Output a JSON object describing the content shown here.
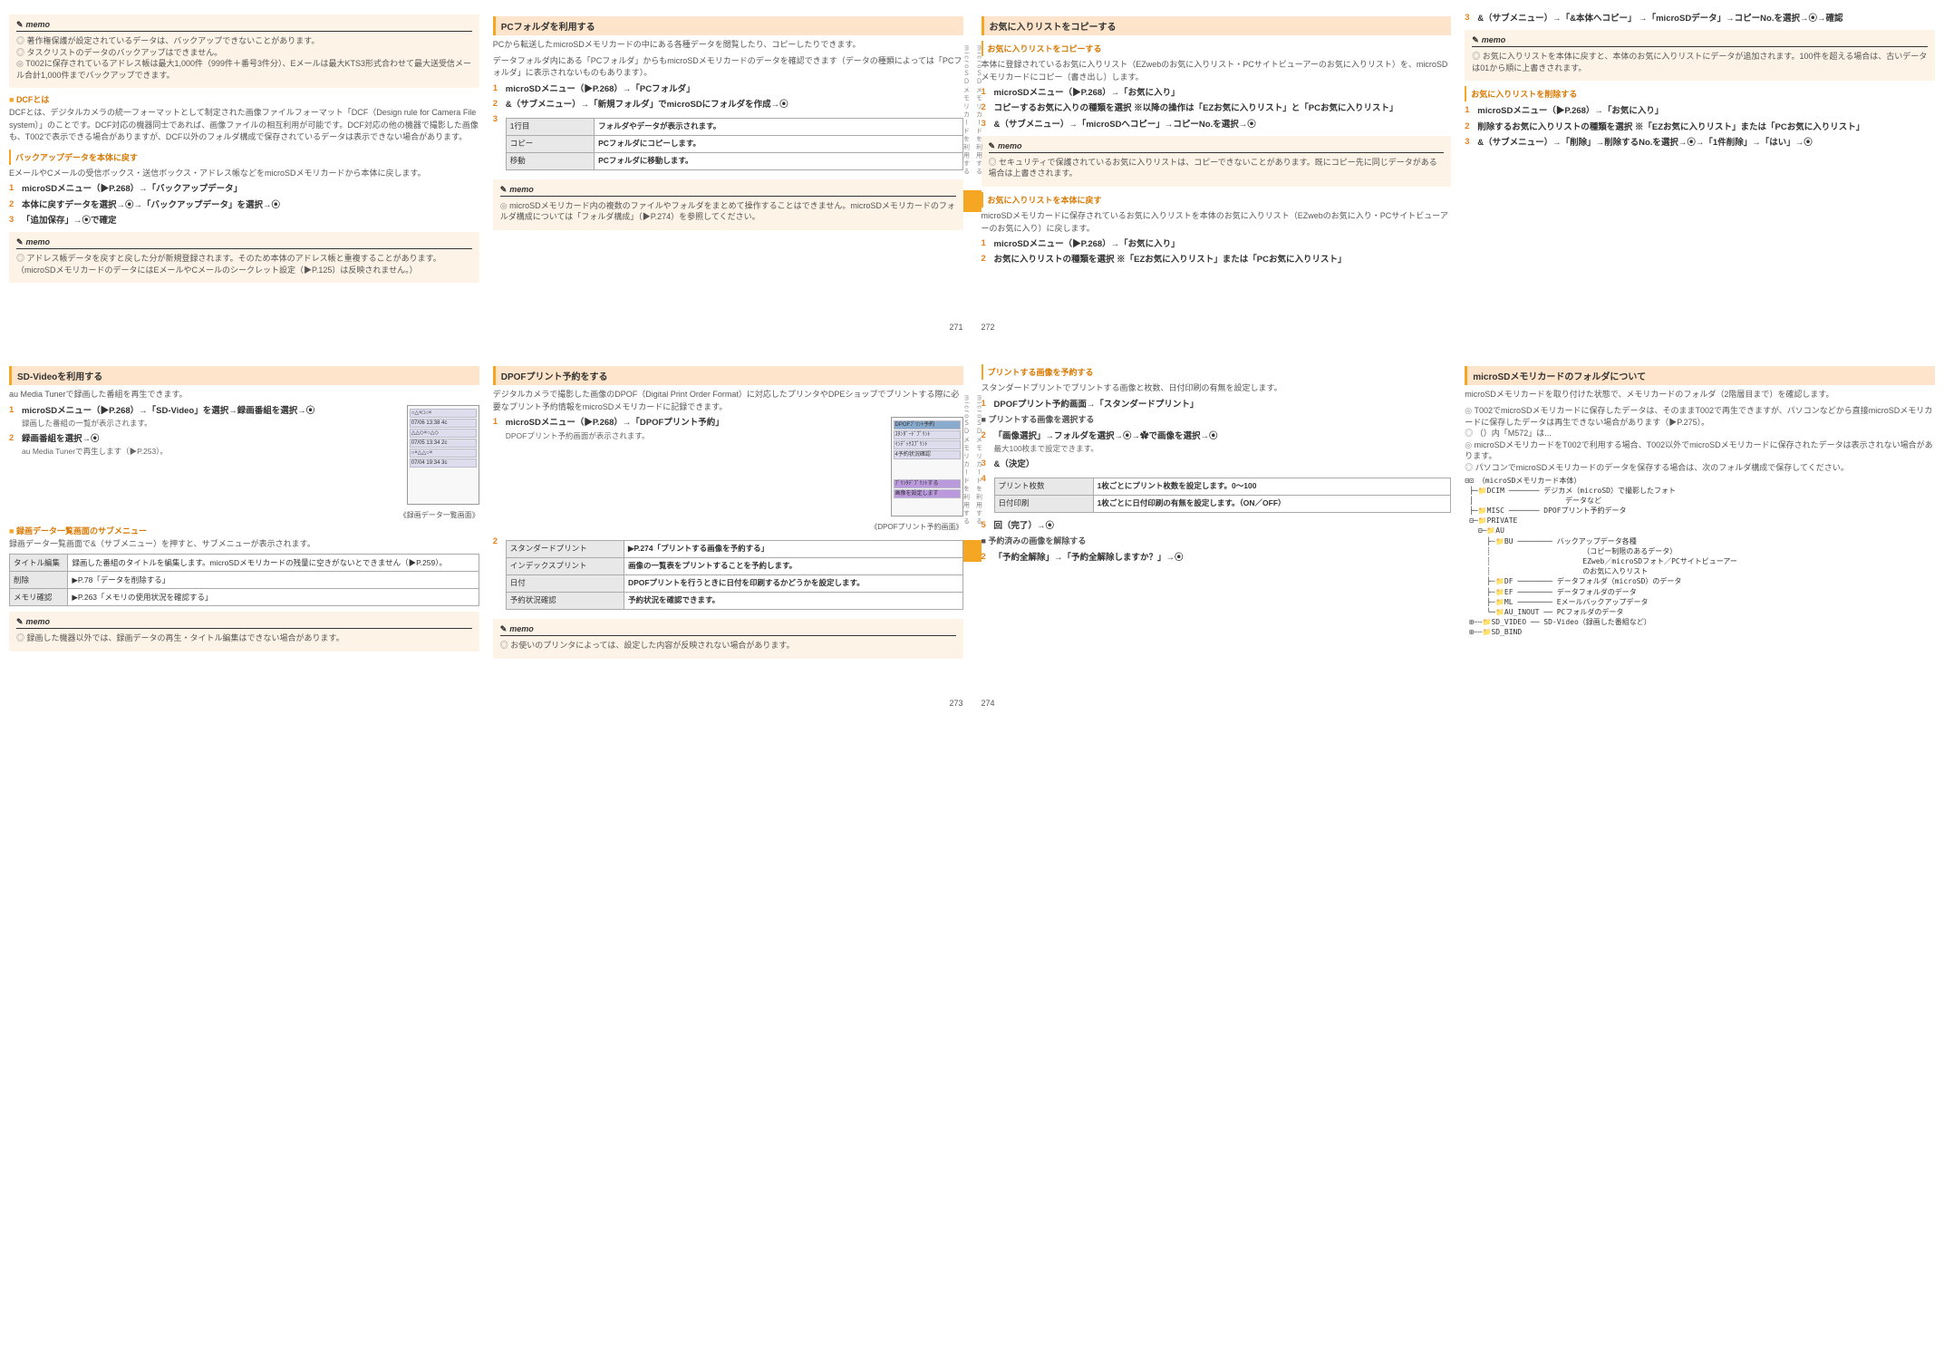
{
  "pageNumbers": [
    "271",
    "272",
    "273",
    "274"
  ],
  "sideLabel": "microＳＤメモリカードを利用する",
  "row1": {
    "colA": {
      "memo1": {
        "title": "memo",
        "items": [
          "著作権保護が設定されているデータは、バックアップできないことがあります。",
          "タスクリストのデータのバックアップはできません。",
          "T002に保存されているアドレス帳は最大1,000件（999件＋番号3件分）、Eメールは最大KTS3形式合わせて最大送受信メール合計1,000件までバックアップできます。"
        ]
      },
      "dcfHdr": "DCFとは",
      "dcfBody": "DCFとは、デジタルカメラの統一フォーマットとして制定された画像ファイルフォーマット「DCF（Design rule for Camera File system）」のことです。DCF対応の機器同士であれば、画像ファイルの相互利用が可能です。DCF対応の他の機器で撮影した画像も、T002で表示できる場合がありますが、DCF以外のフォルダ構成で保存されているデータは表示できない場合があります。",
      "restoreHdr": "バックアップデータを本体に戻す",
      "restoreBody": "EメールやCメールの受信ボックス・送信ボックス・アドレス帳などをmicroSDメモリカードから本体に戻します。",
      "restoreSteps": [
        {
          "n": "1",
          "t": "microSDメニュー（▶P.268）→「バックアップデータ」"
        },
        {
          "n": "2",
          "t": "本体に戻すデータを選択→⦿→「バックアップデータ」を選択→⦿"
        },
        {
          "n": "3",
          "t": "「追加保存」→⦿で確定",
          "sub": ""
        }
      ],
      "memo2": {
        "title": "memo",
        "items": [
          "アドレス帳データを戻すと戻した分が新規登録されます。そのため本体のアドレス帳と重複することがあります。（microSDメモリカードのデータにはEメールやCメールのシークレット設定（▶P.125）は反映されません。）"
        ]
      }
    },
    "colB": {
      "hdr": "PCフォルダを利用する",
      "body1": "PCから転送したmicroSDメモリカードの中にある各種データを閲覧したり、コピーしたりできます。",
      "body2": "データフォルダ内にある「PCフォルダ」からもmicroSDメモリカードのデータを確認できます（データの種類によっては「PCフォルダ」に表示されないものもあります）。",
      "steps": [
        {
          "n": "1",
          "t": "microSDメニュー（▶P.268）→「PCフォルダ」"
        },
        {
          "n": "2",
          "t": "&（サブメニュー）→「新規フォルダ」でmicroSDにフォルダを作成→⦿"
        },
        {
          "n": "3",
          "t": ""
        }
      ],
      "table": [
        [
          "1行目",
          "フォルダやデータが表示されます。"
        ],
        [
          "コピー",
          "PCフォルダにコピーします。"
        ],
        [
          "移動",
          "PCフォルダに移動します。"
        ]
      ],
      "memo": {
        "title": "memo",
        "items": [
          "microSDメモリカード内の複数のファイルやフォルダをまとめて操作することはできません。microSDメモリカードのフォルダ構成については「フォルダ構成」（▶P.274）を参照してください。"
        ]
      }
    },
    "colC": {
      "hdr": "お気に入りリストをコピーする",
      "subhdr": "お気に入りリストをコピーする",
      "body": "本体に登録されているお気に入りリスト（EZwebのお気に入りリスト・PCサイトビューアーのお気に入りリスト）を、microSDメモリカードにコピー（書き出し）します。",
      "steps": [
        {
          "n": "1",
          "t": "microSDメニュー（▶P.268）→「お気に入り」"
        },
        {
          "n": "2",
          "t": "コピーするお気に入りの種類を選択 ※以降の操作は「EZお気に入りリスト」と「PCお気に入りリスト」"
        },
        {
          "n": "3",
          "t": "&（サブメニュー）→「microSDへコピー」→コピーNo.を選択→⦿"
        }
      ],
      "memo": {
        "title": "memo",
        "items": [
          "セキュリティで保護されているお気に入りリストは、コピーできないことがあります。既にコピー先に同じデータがある場合は上書きされます。"
        ]
      },
      "subhdr2": "お気に入りリストを本体に戻す",
      "body2": "microSDメモリカードに保存されているお気に入りリストを本体のお気に入りリスト（EZwebのお気に入り・PCサイトビューアーのお気に入り）に戻します。",
      "steps2": [
        {
          "n": "1",
          "t": "microSDメニュー（▶P.268）→「お気に入り」"
        },
        {
          "n": "2",
          "t": "お気に入りリストの種類を選択 ※「EZお気に入りリスト」または「PCお気に入りリスト」"
        }
      ]
    },
    "colD": {
      "step3": {
        "n": "3",
        "t": "&（サブメニュー）→「&本体へコピー」 →「microSDデータ」→コピーNo.を選択→⦿→確認"
      },
      "memo": {
        "title": "memo",
        "items": [
          "お気に入りリストを本体に戻すと、本体のお気に入りリストにデータが追加されます。100件を超える場合は、古いデータは01から順に上書きされます。"
        ]
      },
      "subhdr": "お気に入りリストを削除する",
      "steps": [
        {
          "n": "1",
          "t": "microSDメニュー（▶P.268）→「お気に入り」"
        },
        {
          "n": "2",
          "t": "削除するお気に入りリストの種類を選択 ※「EZお気に入りリスト」または「PCお気に入りリスト」"
        },
        {
          "n": "3",
          "t": "&（サブメニュー）→「削除」→削除するNo.を選択→⦿→「1件削除」→「はい」→⦿"
        }
      ]
    }
  },
  "row2": {
    "colA": {
      "hdr": "SD-Videoを利用する",
      "body": "au Media Tunerで録画した番組を再生できます。",
      "steps": [
        {
          "n": "1",
          "t": "microSDメニュー（▶P.268）→「SD-Video」を選択→録画番組を選択→⦿",
          "sub": "録画した番組の一覧が表示されます。"
        },
        {
          "n": "2",
          "t": "録画番組を選択→⦿",
          "sub": "au Media Tunerで再生します（▶P.253）。"
        }
      ],
      "screenshotCaption": "《録画データ一覧画面》",
      "screenshotLines": [
        "○△×□○×",
        "07/06 13:38 4c",
        "△△◇×○△◇",
        "07/05 13:34 2c",
        "○×△△○×",
        "07/04 19:34 3c"
      ],
      "subhdr": "録画データ一覧画面のサブメニュー",
      "subBody": "録画データ一覧画面で&（サブメニュー）を押すと、サブメニューが表示されます。",
      "table": [
        [
          "タイトル編集",
          "録画した番組のタイトルを編集します。microSDメモリカードの残量に空きがないとできません（▶P.259）。"
        ],
        [
          "削除",
          "▶P.78「データを削除する」"
        ],
        [
          "メモリ確認",
          "▶P.263「メモリの使用状況を確認する」"
        ]
      ],
      "memo": {
        "title": "memo",
        "items": [
          "録画した機器以外では、録画データの再生・タイトル編集はできない場合があります。"
        ]
      }
    },
    "colB": {
      "hdr": "DPOFプリント予約をする",
      "body": "デジタルカメラで撮影した画像のDPOF（Digital Print Order Format）に対応したプリンタやDPEショップでプリントする際に必要なプリント予約情報をmicroSDメモリカードに記録できます。",
      "steps": [
        {
          "n": "1",
          "t": "microSDメニュー（▶P.268）→「DPOFプリント予約」",
          "sub": "DPOFプリント予約画面が表示されます。"
        }
      ],
      "screenshotCaption": "《DPOFプリント予約画面》",
      "screenshotLines": [
        "DPOFﾌﾟﾘﾝﾄ予約",
        "ｽﾀﾝﾀﾞｰﾄﾞﾌﾟﾘﾝﾄ",
        "ｲﾝﾃﾞｯｸｽﾌﾟﾘﾝﾄ",
        "4予約状況確認",
        "ﾌﾟﾘﾝﾀﾃﾞﾌﾟﾘﾝﾄする",
        "画像を設定します"
      ],
      "step2": {
        "n": "2",
        "t": ""
      },
      "table": [
        [
          "スタンダードプリント",
          "▶P.274「プリントする画像を予約する」"
        ],
        [
          "インデックスプリント",
          "画像の一覧表をプリントすることを予約します。"
        ],
        [
          "日付",
          "DPOFプリントを行うときに日付を印刷するかどうかを設定します。"
        ],
        [
          "予約状況確認",
          "予約状況を確認できます。"
        ]
      ],
      "memo": {
        "title": "memo",
        "items": [
          "お使いのプリンタによっては、設定した内容が反映されない場合があります。"
        ]
      }
    },
    "colC": {
      "subhdr": "プリントする画像を予約する",
      "body": "スタンダードプリントでプリントする画像と枚数、日付印刷の有無を設定します。",
      "steps": [
        {
          "n": "1",
          "t": "DPOFプリント予約画面→「スタンダードプリント」"
        }
      ],
      "blk1": "■ プリントする画像を選択する",
      "steps2": [
        {
          "n": "2",
          "t": "「画像選択」→フォルダを選択→⦿→✿で画像を選択→⦿",
          "sub": "最大100枚まで設定できます。"
        },
        {
          "n": "3",
          "t": "&（決定）"
        },
        {
          "n": "4",
          "t": ""
        }
      ],
      "table": [
        [
          "プリント枚数",
          "1枚ごとにプリント枚数を設定します。0〜100"
        ],
        [
          "日付印刷",
          "1枚ごとに日付印刷の有無を設定します。（ON／OFF）"
        ]
      ],
      "step5": {
        "n": "5",
        "t": "回（完了）→⦿"
      },
      "blk2": "■ 予約済みの画像を解除する",
      "steps3": [
        {
          "n": "2",
          "t": "「予約全解除」→「予約全解除しますか？」→⦿"
        }
      ]
    },
    "colD": {
      "hdr": "microSDメモリカードのフォルダについて",
      "body1": "microSDメモリカードを取り付けた状態で、メモリカードのフォルダ（2階層目まで）を確認します。",
      "bodyItems": [
        "T002でmicroSDメモリカードに保存したデータは、そのままT002で再生できますが、パソコンなどから直接microSDメモリカードに保存したデータは再生できない場合があります（▶P.275）。",
        "（）内「M572」は...",
        "microSDメモリカードをT002で利用する場合、T002以外でmicroSDメモリカードに保存されたデータは表示されない場合があります。",
        "パソコンでmicroSDメモリカードのデータを保存する場合は、次のフォルダ構成で保存してください。"
      ],
      "tree": [
        "⊟⊡ （microSDメモリカード本体）",
        " ├─📁DCIM ─────── デジカメ（microSD）で撮影したフォト",
        " │                     データなど",
        " ├─📁MISC ─────── DPOFプリント予約データ",
        " ⊟─📁PRIVATE",
        "   ⊟─📁AU",
        "     ├┄📁BU ──────── バックアップデータ各種",
        "     ┊                     （コピー制限のあるデータ）",
        "     ┊                     EZweb／microSDフォト／PCサイトビューアー",
        "     ┊                     のお気に入りリスト",
        "     ├┄📁DF ──────── データフォルダ（microSD）のデータ",
        "     ├┄📁EF ──────── データフォルダのデータ",
        "     ├┄📁ML ──────── Eメールバックアップデータ",
        "     └─📁AU_INOUT ── PCフォルダのデータ",
        " ⊞┄┄📁SD_VIDEO ── SD-Video（録画した番組など）",
        " ⊞┄┄📁SD_BIND"
      ]
    }
  }
}
